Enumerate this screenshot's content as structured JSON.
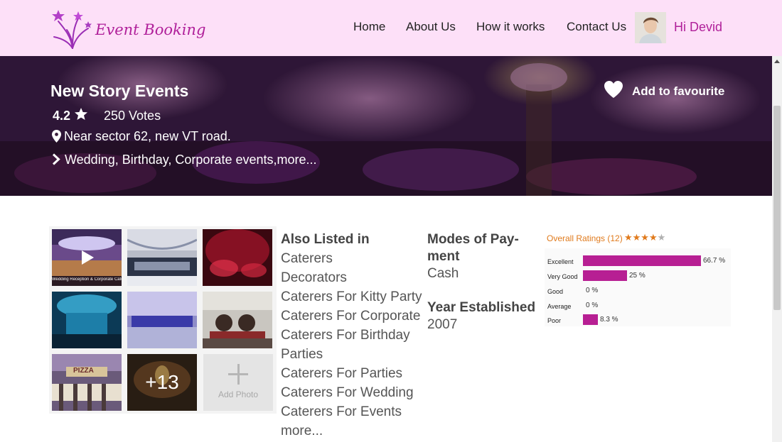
{
  "brand": {
    "name": "Event Booking"
  },
  "nav": {
    "items": [
      "Home",
      "About Us",
      "How it works",
      "Contact Us"
    ]
  },
  "user": {
    "greeting": "Hi Devid"
  },
  "venue": {
    "name": "New Story Events",
    "rating": "4.2",
    "votes": "250 Votes",
    "address": "Near sector 62, new VT road.",
    "categories": "Wedding, Birthday, Corporate events,more...",
    "favourite_label": "Add to favourite"
  },
  "gallery": {
    "more_count": "+13",
    "add_photo_label": "Add Photo",
    "first_caption": "Wedding Reception & Corporate Catering",
    "pizza_sign": "PIZZA"
  },
  "also_listed": {
    "title": "Also Listed in",
    "items": [
      "Caterers",
      "Decorators",
      "Caterers For Kitty Party",
      "Caterers For Corporate",
      "Caterers For Birthday",
      "Parties",
      "Caterers For Parties",
      "Caterers For Wedding",
      "Caterers For Events"
    ],
    "more_label": "more..."
  },
  "payment": {
    "title_line1": "Modes of Pay-",
    "title_line2": "ment",
    "value": "Cash"
  },
  "established": {
    "title": "Year Established",
    "value": "2007"
  },
  "ratings": {
    "overall_label": "Overall Ratings (12)",
    "stars": "★★★★★",
    "rows": [
      {
        "label": "Excellent",
        "pct_label": "66.7 %",
        "fraction": 0.667
      },
      {
        "label": "Very Good",
        "pct_label": "25 %",
        "fraction": 0.25
      },
      {
        "label": "Good",
        "pct_label": "0 %",
        "fraction": 0
      },
      {
        "label": "Average",
        "pct_label": "0 %",
        "fraction": 0
      },
      {
        "label": "Poor",
        "pct_label": "8.3 %",
        "fraction": 0.083
      }
    ]
  },
  "colors": {
    "header_bg": "#fde0f8",
    "brand_accent": "#b0209a",
    "bar_color": "#b71f93",
    "overall_color": "#e07a1c"
  },
  "icons": [
    "fireworks-logo-icon",
    "star-icon",
    "map-pin-icon",
    "chevron-right-icon",
    "heart-icon",
    "play-icon",
    "plus-icon",
    "scroll-up-arrow-icon"
  ]
}
